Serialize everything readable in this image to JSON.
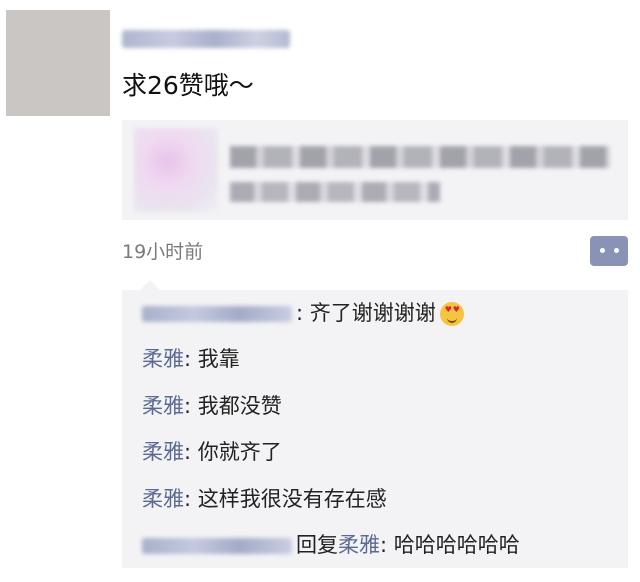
{
  "post": {
    "text": "求26赞哦～",
    "timestamp": "19小时前"
  },
  "comments": [
    {
      "author": "",
      "body": "齐了谢谢谢谢",
      "emoji": "smiling-face-with-heart-eyes"
    },
    {
      "author": "柔雅",
      "body": "我靠"
    },
    {
      "author": "柔雅",
      "body": "我都没赞"
    },
    {
      "author": "柔雅",
      "body": "你就齐了"
    },
    {
      "author": "柔雅",
      "body": "这样我很没有存在感"
    },
    {
      "author": "",
      "reply_word": "回复",
      "reply_to": "柔雅",
      "body": "哈哈哈哈哈哈"
    }
  ],
  "separator": ": ",
  "icons": {
    "comment": "comment-bubble-icon"
  },
  "colors": {
    "author": "#5b6a94",
    "comment_button": "#8a93b5",
    "card_bg": "#f3f3f5"
  }
}
